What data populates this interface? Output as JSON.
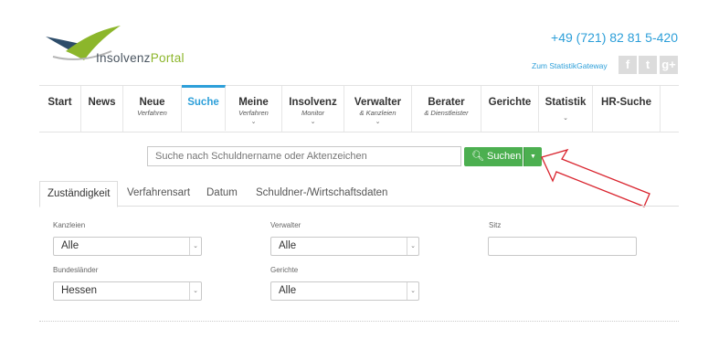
{
  "brand": {
    "name_part1": "Insolvenz",
    "name_part2": "Portal",
    "color_green": "#8cb62b",
    "color_dark": "#2d4d6a"
  },
  "header": {
    "phone": "+49 (721) 82 81 5-420",
    "statistik_link": "Zum StatistikGateway",
    "social": [
      "facebook-icon",
      "twitter-icon",
      "googleplus-icon"
    ],
    "accent_color": "#2d9fd9"
  },
  "nav": {
    "items": [
      {
        "label": "Start",
        "sub": ""
      },
      {
        "label": "News",
        "sub": ""
      },
      {
        "label": "Neue",
        "sub": "Verfahren"
      },
      {
        "label": "Suche",
        "sub": ""
      },
      {
        "label": "Meine",
        "sub": "Verfahren"
      },
      {
        "label": "Insolvenz",
        "sub": "Monitor"
      },
      {
        "label": "Verwalter",
        "sub": "& Kanzleien"
      },
      {
        "label": "Berater",
        "sub": "& Dienstleister"
      },
      {
        "label": "Gerichte",
        "sub": ""
      },
      {
        "label": "Statistik",
        "sub": ""
      },
      {
        "label": "HR-Suche",
        "sub": ""
      }
    ],
    "active": "Suche"
  },
  "search": {
    "placeholder": "Suche nach Schuldnername oder Aktenzeichen",
    "value": "",
    "button_label": "Suchen",
    "button_color": "#4caf50"
  },
  "annotation": {
    "arrow_color": "#d9232d"
  },
  "tabs": {
    "items": [
      "Zuständigkeit",
      "Verfahrensart",
      "Datum",
      "Schuldner-/Wirtschaftsdaten"
    ],
    "active": "Zuständigkeit"
  },
  "filters": {
    "kanzleien": {
      "label": "Kanzleien",
      "value": "Alle"
    },
    "verwalter": {
      "label": "Verwalter",
      "value": "Alle"
    },
    "sitz": {
      "label": "Sitz",
      "value": ""
    },
    "bundeslaender": {
      "label": "Bundesländer",
      "value": "Hessen"
    },
    "gerichte": {
      "label": "Gerichte",
      "value": "Alle"
    }
  }
}
